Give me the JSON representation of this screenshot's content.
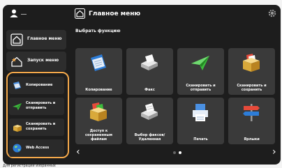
{
  "header": {
    "home_title": "Главное меню",
    "user_icon": "user-icon",
    "settings_icon": "gear-icon"
  },
  "sidebar": {
    "top_items": [
      {
        "label": "Главное меню",
        "icon": "home-icon"
      },
      {
        "label": "Запуск меню",
        "icon": "home-star-icon"
      }
    ],
    "favorites": [
      {
        "label": "Копирование",
        "icon": "copy-icon"
      },
      {
        "label": "Сканировать и отправить",
        "icon": "send-icon"
      },
      {
        "label": "Сканировать и сохранить",
        "icon": "box-icon"
      },
      {
        "label": "Web Access",
        "icon": "globe-icon"
      }
    ]
  },
  "main": {
    "section_label": "Выбрать функцию",
    "tiles": [
      {
        "label": "Копирование",
        "icon": "copy-icon"
      },
      {
        "label": "Факс",
        "icon": "fax-icon"
      },
      {
        "label": "Сканировать и отправить",
        "icon": "send-icon"
      },
      {
        "label": "Сканировать и сохранить",
        "icon": "box-icon"
      },
      {
        "label": "Доступ к сохраненным файлам",
        "icon": "stored-files-icon"
      },
      {
        "label": "Выбор факсов/Удаленная",
        "icon": "fax-inbox-icon"
      },
      {
        "label": "Печать",
        "icon": "print-icon"
      },
      {
        "label": "Ярлыки",
        "icon": "signpost-icon"
      }
    ],
    "prev_arrow": "‹",
    "next_arrow": "›",
    "page_count": 2,
    "current_page": 2
  },
  "status_text": "Для регистрации избранных",
  "colors": {
    "screen_bg": "#1d1d1d",
    "tile_bg": "#3a3a3a",
    "highlight": "#f5a94b",
    "accent_blue": "#2d7dd8",
    "accent_green": "#3dbb3d"
  }
}
